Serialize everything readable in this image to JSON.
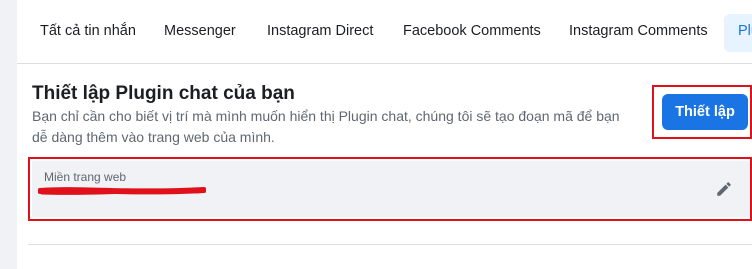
{
  "tabs": [
    {
      "label": "Tất cả tin nhắn"
    },
    {
      "label": "Messenger"
    },
    {
      "label": "Instagram Direct"
    },
    {
      "label": "Facebook Comments"
    },
    {
      "label": "Instagram Comments"
    },
    {
      "label": "Plu"
    }
  ],
  "plugin": {
    "title": "Thiết lập Plugin chat của bạn",
    "description": "Bạn chỉ cần cho biết vị trí mà mình muốn hiển thị Plugin chat, chúng tôi sẽ tạo đoạn mã để bạn dễ dàng thêm vào trang web của mình.",
    "setup_button": "Thiết lập"
  },
  "domain": {
    "label": "Miền trang web",
    "value": ""
  },
  "icons": {
    "edit": "pencil-icon"
  },
  "colors": {
    "primary": "#1b74e4",
    "annotation": "#e0111b",
    "background": "#f0f2f5"
  }
}
